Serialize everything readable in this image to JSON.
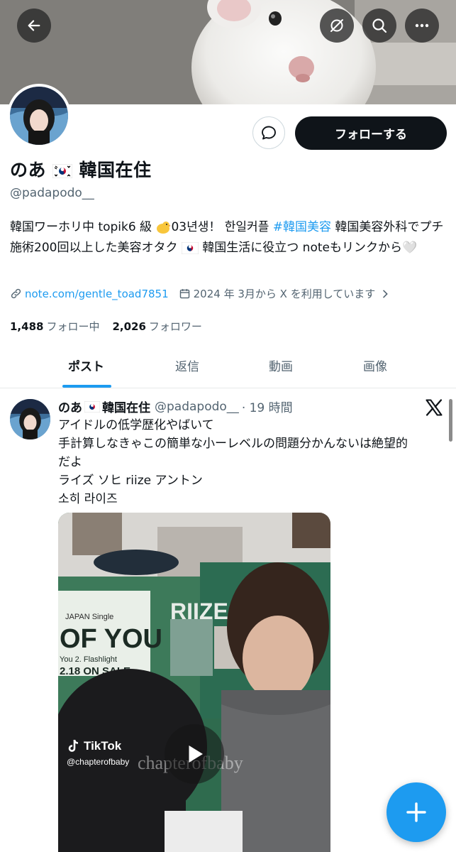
{
  "profile": {
    "display_name": "のあ",
    "display_name_suffix": "韓国在住",
    "handle": "@padapodo__",
    "follow_label": "フォローする",
    "bio": {
      "part1": "韓国ワーホリ中 topik6 級 ",
      "part2": "03년생！ 한일커플 ",
      "hashtag": "#韓国美容",
      "part3": " 韓国美容外科でプチ施術200回以上した美容オタク",
      "part4": " 韓国生活に役立つ noteもリンクから",
      "heart": "🤍"
    },
    "link": "note.com/gentle_toad7851",
    "joined": "2024 年 3月から X を利用しています",
    "following_count": "1,488",
    "following_label": "フォロー中",
    "followers_count": "2,026",
    "followers_label": "フォロワー"
  },
  "tabs": [
    {
      "label": "ポスト",
      "active": true
    },
    {
      "label": "返信",
      "active": false
    },
    {
      "label": "動画",
      "active": false
    },
    {
      "label": "画像",
      "active": false
    }
  ],
  "post": {
    "author_name": "のあ",
    "author_suffix": "韓国在住",
    "author_handle": "@padapodo__",
    "time": "· 19 時間",
    "lines": [
      "アイドルの低学歴化やばいて",
      "手計算しなきゃこの簡単な小ーレベルの問題分かんないは絶望的",
      "だよ",
      "ライズ ソヒ riize アントン",
      "소히 라이즈"
    ],
    "media": {
      "poster_text_1": "OF YOU",
      "poster_text_2": "RIIZE",
      "poster_text_3": "2.18 ON SALE",
      "poster_text_4": "JAPAN Single",
      "poster_text_5": "You   2. Flashlight",
      "tiktok_label": "TikTok",
      "tiktok_user": "@chapterofbaby",
      "watermark": "chapterofbaby"
    }
  },
  "colors": {
    "accent": "#1d9bf0",
    "text_primary": "#0f1419",
    "text_secondary": "#536471",
    "follow_bg": "#0f1419"
  },
  "icons": [
    "back-arrow-icon",
    "hide-eye-icon",
    "search-icon",
    "more-icon",
    "message-icon",
    "link-icon",
    "calendar-icon",
    "chevron-right-icon",
    "x-logo-icon",
    "play-icon",
    "plus-icon",
    "korea-flag-icon",
    "heart-icon",
    "chick-emoji-icon"
  ]
}
